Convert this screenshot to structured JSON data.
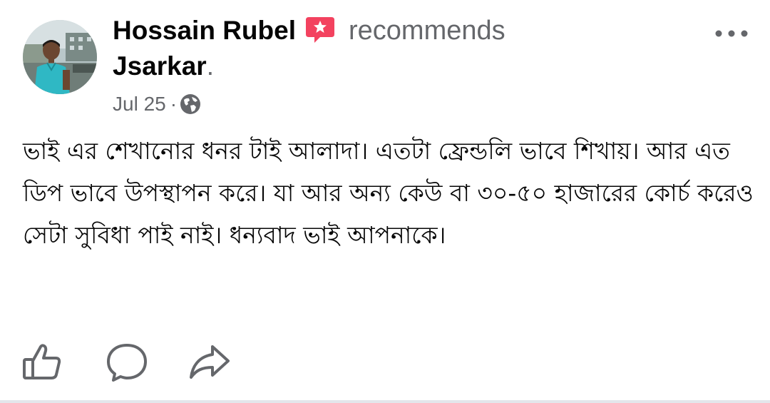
{
  "post": {
    "author_name": "Hossain Rubel",
    "action_text": "recommends",
    "page_name": "Jsarkar",
    "page_suffix": ".",
    "timestamp": "Jul 25",
    "separator": "·",
    "privacy_icon": "globe-icon",
    "recommend_icon": "recommend-badge-icon",
    "more_icon": "more-options-icon",
    "body_text": "ভাই এর শেখানোর ধনর টাই আলাদা। এতটা ফ্রেন্ডলি ভাবে শিখায়। আর এত ডিপ ভাবে উপস্থাপন করে। যা আর অন্য কেউ বা ৩০-৫০ হাজারের কোর্চ করেও সেটা সুবিধা পাই নাই। ধন্যবাদ ভাই আপনাকে।"
  },
  "actions": {
    "like_icon": "thumbs-up-icon",
    "comment_icon": "comment-icon",
    "share_icon": "share-icon"
  },
  "colors": {
    "text_primary": "#050505",
    "text_secondary": "#65676b",
    "recommend_red": "#f3425f",
    "icon_gray": "#65676b",
    "divider": "#e4e6eb"
  }
}
